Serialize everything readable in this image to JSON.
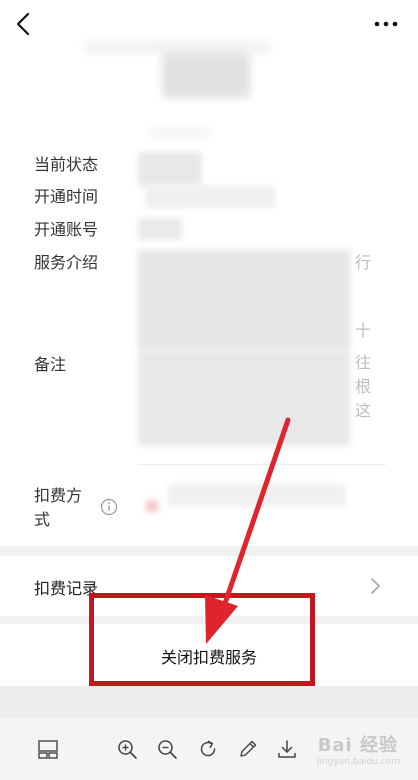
{
  "rows": {
    "status": "当前状态",
    "open_time": "开通时间",
    "open_account": "开通账号",
    "service_intro": "服务介绍",
    "remarks": "备注",
    "deduct_method_line1": "扣费方",
    "deduct_method_line2": "式"
  },
  "edge_glyphs": [
    "行",
    "十",
    "往",
    "根",
    "这"
  ],
  "deduct_records": {
    "label": "扣费记录"
  },
  "close_service": {
    "label": "关闭扣费服务"
  },
  "watermark": {
    "brand": "Bai 经验",
    "url": "jingyan.baidu.com"
  },
  "colors": {
    "accent_red": "#c4161c",
    "band_gray": "#f1f1f1",
    "toolbar_bg": "#f4f4f4"
  },
  "icons": [
    "back-arrow-icon",
    "more-dots-icon",
    "info-icon",
    "chevron-right-icon",
    "layout-icon",
    "zoom-in-icon",
    "zoom-out-icon",
    "rotate-icon",
    "edit-pen-icon",
    "download-icon"
  ]
}
